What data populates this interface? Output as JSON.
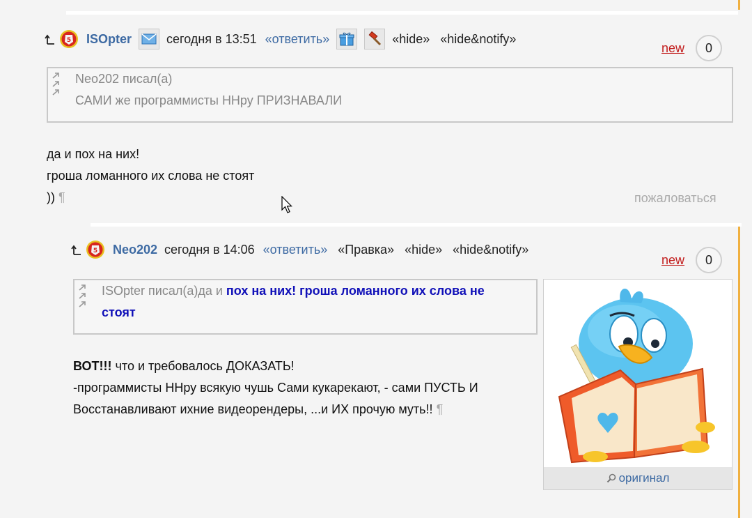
{
  "colors": {
    "accent": "#3d6aa3",
    "new": "#c21d1d",
    "highlight": "#1010b8",
    "bar": "#f0b040"
  },
  "comment1": {
    "author": "ISOpter",
    "time": "сегодня в 13:51",
    "reply": "«ответить»",
    "hide": "«hide»",
    "hide_notify": "«hide&notify»",
    "new": "new",
    "count": "0",
    "quote": {
      "header": "Neo202 писал(а)",
      "text": "САМИ же программисты ННру ПРИЗНАВАЛИ"
    },
    "body": [
      "да и пох на них!",
      "гроша ломанного их слова не стоят",
      "))"
    ],
    "pilcrow": "¶",
    "complain": "пожаловаться"
  },
  "comment2": {
    "author": "Neo202",
    "time": "сегодня в 14:06",
    "reply": "«ответить»",
    "edit": "«Правка»",
    "hide": "«hide»",
    "hide_notify": "«hide&notify»",
    "new": "new",
    "count": "0",
    "quote": {
      "prefix": "ISOpter писал(а)да и ",
      "bold_line1": "пох на них! гроша ломанного их слова не",
      "bold_line2": "стоят"
    },
    "body_bold": "ВОТ!!!",
    "body_line1_rest": " что и требовалось ДОКАЗАТЬ!",
    "body_line2": "-программисты ННру всякую чушь Сами кукарекают, - сами ПУСТЬ И",
    "body_line3": "Восстанавливают ихние видеорендеры, ...и ИХ прочую муть!!",
    "pilcrow": "¶",
    "image_caption": "оригинал"
  }
}
